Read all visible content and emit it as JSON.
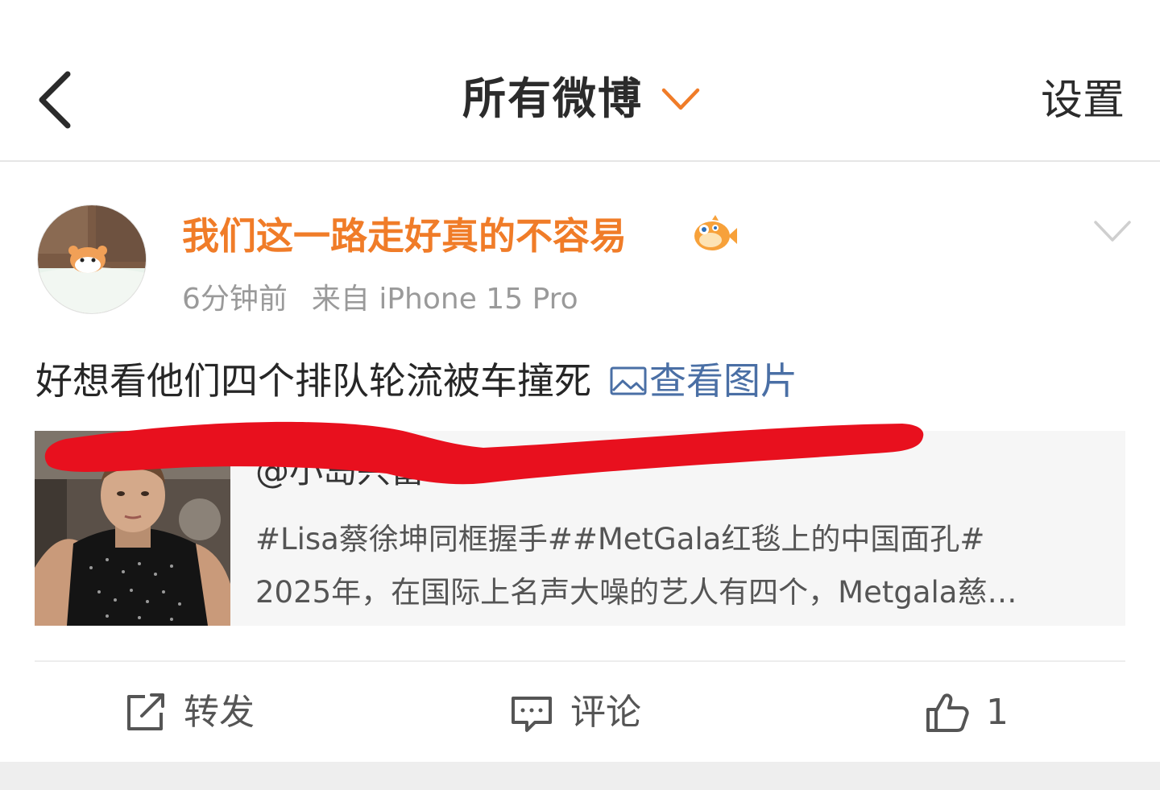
{
  "header": {
    "title": "所有微博",
    "settings_label": "设置"
  },
  "post": {
    "username": "我们这一路走好真的不容易",
    "time": "6分钟前",
    "source": "来自 iPhone 15 Pro",
    "text": "好想看他们四个排队轮流被车撞死",
    "view_image_label": "查看图片",
    "repost": {
      "author": "@小岛兴富",
      "line1": "#Lisa蔡徐坤同框握手##MetGala红毯上的中国面孔#",
      "line2": "2025年，在国际上名声大噪的艺人有四个，Metgala慈…"
    },
    "actions": {
      "repost_label": "转发",
      "comment_label": "评论",
      "like_count": "1"
    }
  },
  "colors": {
    "username": "#f07c28",
    "link": "#4a6fa5",
    "redaction": "#e8101e"
  },
  "icons": [
    "back-arrow-icon",
    "chevron-down-icon",
    "puffer-fish-badge-icon",
    "image-icon",
    "share-icon",
    "comment-icon",
    "thumbs-up-icon"
  ]
}
